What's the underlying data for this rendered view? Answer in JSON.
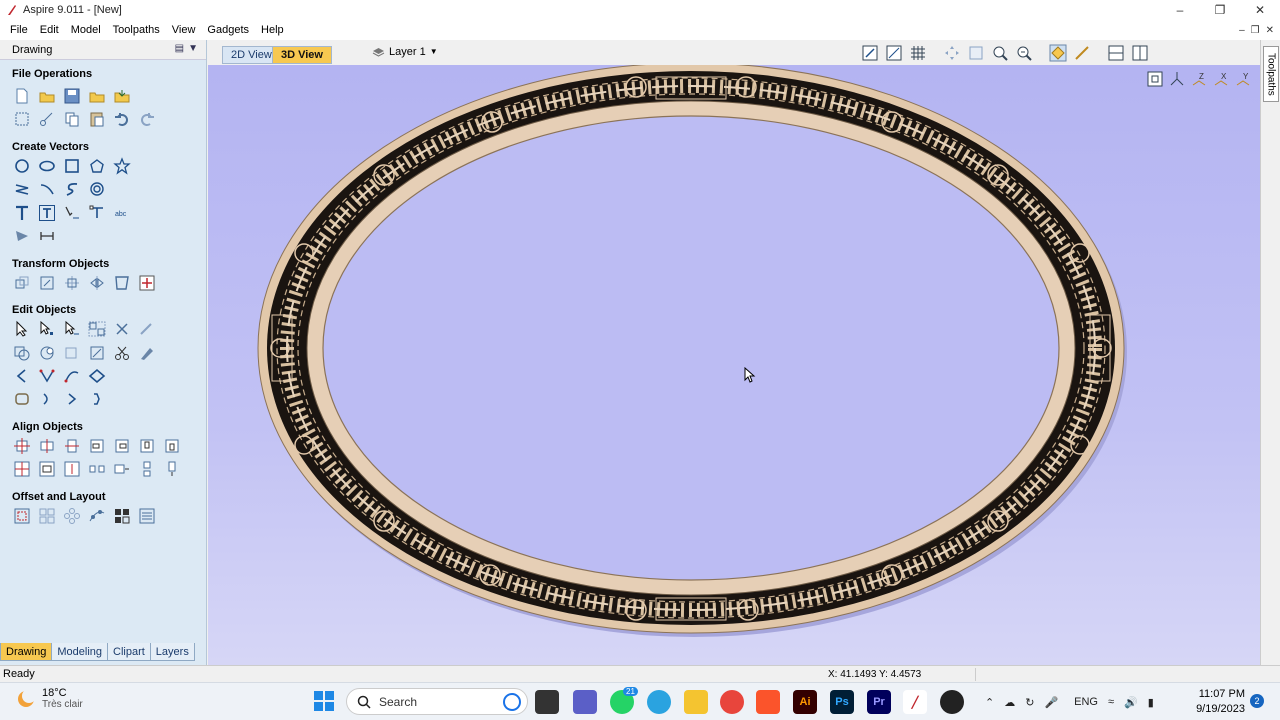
{
  "window": {
    "title": "Aspire 9.011 - [New]"
  },
  "menu": {
    "items": [
      "File",
      "Edit",
      "Model",
      "Toolpaths",
      "View",
      "Gadgets",
      "Help"
    ]
  },
  "panel": {
    "header": "Drawing",
    "sections": {
      "file_operations": "File Operations",
      "create_vectors": "Create Vectors",
      "transform_objects": "Transform Objects",
      "edit_objects": "Edit Objects",
      "align_objects": "Align Objects",
      "offset_layout": "Offset and Layout"
    },
    "tabs": [
      "Drawing",
      "Modeling",
      "Clipart",
      "Layers"
    ],
    "active_tab": "Drawing"
  },
  "view": {
    "tab_2d": "2D View",
    "tab_3d": "3D View",
    "active": "3D View",
    "layer": "Layer 1"
  },
  "right_strip": {
    "label": "Toolpaths"
  },
  "axis_labels": [
    "Z",
    "X",
    "Y"
  ],
  "status": {
    "text": "Ready",
    "coords": "X: 41.1493 Y: 4.4573"
  },
  "taskbar": {
    "temperature": "18°C",
    "condition": "Très clair",
    "search_placeholder": "Search",
    "language": "ENG",
    "time": "11:07 PM",
    "date": "9/19/2023",
    "notification_count": "2",
    "badge_count": "21"
  },
  "colors": {
    "accent_tab": "#f7c850",
    "panel_bg": "#dce9f4",
    "viewport_bg": "#b4b4f2",
    "wood": "#e6cfb6",
    "inlay": "#1a1410"
  }
}
